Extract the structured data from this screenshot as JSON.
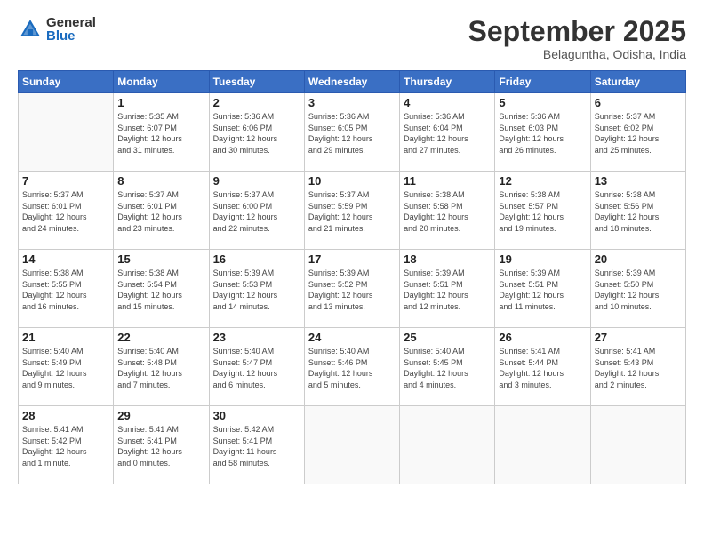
{
  "logo": {
    "general": "General",
    "blue": "Blue"
  },
  "header": {
    "month": "September 2025",
    "location": "Belaguntha, Odisha, India"
  },
  "weekdays": [
    "Sunday",
    "Monday",
    "Tuesday",
    "Wednesday",
    "Thursday",
    "Friday",
    "Saturday"
  ],
  "weeks": [
    [
      {
        "day": "",
        "info": ""
      },
      {
        "day": "1",
        "info": "Sunrise: 5:35 AM\nSunset: 6:07 PM\nDaylight: 12 hours\nand 31 minutes."
      },
      {
        "day": "2",
        "info": "Sunrise: 5:36 AM\nSunset: 6:06 PM\nDaylight: 12 hours\nand 30 minutes."
      },
      {
        "day": "3",
        "info": "Sunrise: 5:36 AM\nSunset: 6:05 PM\nDaylight: 12 hours\nand 29 minutes."
      },
      {
        "day": "4",
        "info": "Sunrise: 5:36 AM\nSunset: 6:04 PM\nDaylight: 12 hours\nand 27 minutes."
      },
      {
        "day": "5",
        "info": "Sunrise: 5:36 AM\nSunset: 6:03 PM\nDaylight: 12 hours\nand 26 minutes."
      },
      {
        "day": "6",
        "info": "Sunrise: 5:37 AM\nSunset: 6:02 PM\nDaylight: 12 hours\nand 25 minutes."
      }
    ],
    [
      {
        "day": "7",
        "info": "Sunrise: 5:37 AM\nSunset: 6:01 PM\nDaylight: 12 hours\nand 24 minutes."
      },
      {
        "day": "8",
        "info": "Sunrise: 5:37 AM\nSunset: 6:01 PM\nDaylight: 12 hours\nand 23 minutes."
      },
      {
        "day": "9",
        "info": "Sunrise: 5:37 AM\nSunset: 6:00 PM\nDaylight: 12 hours\nand 22 minutes."
      },
      {
        "day": "10",
        "info": "Sunrise: 5:37 AM\nSunset: 5:59 PM\nDaylight: 12 hours\nand 21 minutes."
      },
      {
        "day": "11",
        "info": "Sunrise: 5:38 AM\nSunset: 5:58 PM\nDaylight: 12 hours\nand 20 minutes."
      },
      {
        "day": "12",
        "info": "Sunrise: 5:38 AM\nSunset: 5:57 PM\nDaylight: 12 hours\nand 19 minutes."
      },
      {
        "day": "13",
        "info": "Sunrise: 5:38 AM\nSunset: 5:56 PM\nDaylight: 12 hours\nand 18 minutes."
      }
    ],
    [
      {
        "day": "14",
        "info": "Sunrise: 5:38 AM\nSunset: 5:55 PM\nDaylight: 12 hours\nand 16 minutes."
      },
      {
        "day": "15",
        "info": "Sunrise: 5:38 AM\nSunset: 5:54 PM\nDaylight: 12 hours\nand 15 minutes."
      },
      {
        "day": "16",
        "info": "Sunrise: 5:39 AM\nSunset: 5:53 PM\nDaylight: 12 hours\nand 14 minutes."
      },
      {
        "day": "17",
        "info": "Sunrise: 5:39 AM\nSunset: 5:52 PM\nDaylight: 12 hours\nand 13 minutes."
      },
      {
        "day": "18",
        "info": "Sunrise: 5:39 AM\nSunset: 5:51 PM\nDaylight: 12 hours\nand 12 minutes."
      },
      {
        "day": "19",
        "info": "Sunrise: 5:39 AM\nSunset: 5:51 PM\nDaylight: 12 hours\nand 11 minutes."
      },
      {
        "day": "20",
        "info": "Sunrise: 5:39 AM\nSunset: 5:50 PM\nDaylight: 12 hours\nand 10 minutes."
      }
    ],
    [
      {
        "day": "21",
        "info": "Sunrise: 5:40 AM\nSunset: 5:49 PM\nDaylight: 12 hours\nand 9 minutes."
      },
      {
        "day": "22",
        "info": "Sunrise: 5:40 AM\nSunset: 5:48 PM\nDaylight: 12 hours\nand 7 minutes."
      },
      {
        "day": "23",
        "info": "Sunrise: 5:40 AM\nSunset: 5:47 PM\nDaylight: 12 hours\nand 6 minutes."
      },
      {
        "day": "24",
        "info": "Sunrise: 5:40 AM\nSunset: 5:46 PM\nDaylight: 12 hours\nand 5 minutes."
      },
      {
        "day": "25",
        "info": "Sunrise: 5:40 AM\nSunset: 5:45 PM\nDaylight: 12 hours\nand 4 minutes."
      },
      {
        "day": "26",
        "info": "Sunrise: 5:41 AM\nSunset: 5:44 PM\nDaylight: 12 hours\nand 3 minutes."
      },
      {
        "day": "27",
        "info": "Sunrise: 5:41 AM\nSunset: 5:43 PM\nDaylight: 12 hours\nand 2 minutes."
      }
    ],
    [
      {
        "day": "28",
        "info": "Sunrise: 5:41 AM\nSunset: 5:42 PM\nDaylight: 12 hours\nand 1 minute."
      },
      {
        "day": "29",
        "info": "Sunrise: 5:41 AM\nSunset: 5:41 PM\nDaylight: 12 hours\nand 0 minutes."
      },
      {
        "day": "30",
        "info": "Sunrise: 5:42 AM\nSunset: 5:41 PM\nDaylight: 11 hours\nand 58 minutes."
      },
      {
        "day": "",
        "info": ""
      },
      {
        "day": "",
        "info": ""
      },
      {
        "day": "",
        "info": ""
      },
      {
        "day": "",
        "info": ""
      }
    ]
  ]
}
